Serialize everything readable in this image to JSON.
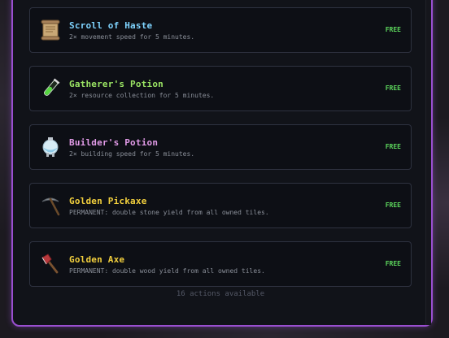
{
  "shop": {
    "items": [
      {
        "name": "Scroll of Haste",
        "description": "2× movement speed for 5 minutes.",
        "price": "FREE",
        "name_color": "#7fd4ff",
        "icon": "scroll-icon"
      },
      {
        "name": "Gatherer's Potion",
        "description": "2× resource collection for 5 minutes.",
        "price": "FREE",
        "name_color": "#9be564",
        "icon": "test-tube-icon"
      },
      {
        "name": "Builder's Potion",
        "description": "2× building speed for 5 minutes.",
        "price": "FREE",
        "name_color": "#e29be8",
        "icon": "flask-icon"
      },
      {
        "name": "Golden Pickaxe",
        "description": "PERMANENT: double stone yield from all owned tiles.",
        "price": "FREE",
        "name_color": "#f2cf3d",
        "icon": "pickaxe-icon"
      },
      {
        "name": "Golden Axe",
        "description": "PERMANENT: double wood yield from all owned tiles.",
        "price": "FREE",
        "name_color": "#f2cf3d",
        "icon": "axe-icon"
      }
    ],
    "footer": "16 actions available",
    "price_color": "#5cd65c",
    "border_accent": "#9a4fd0"
  }
}
